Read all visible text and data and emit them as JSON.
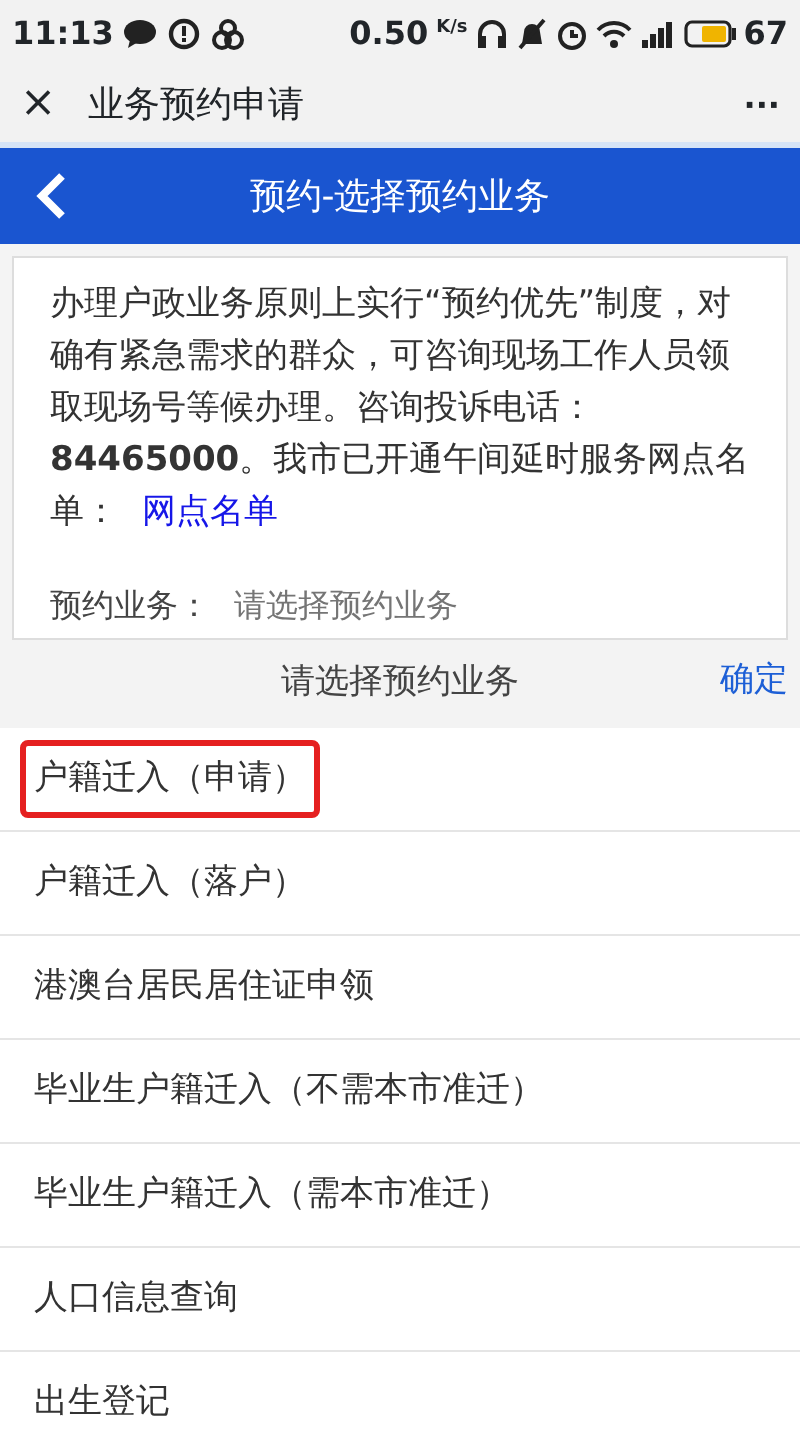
{
  "status_bar": {
    "time": "11:13",
    "speed": "0.50",
    "speed_unit": "K/s",
    "battery": "67"
  },
  "title_bar": {
    "close": "×",
    "title": "业务预约申请",
    "more": "···"
  },
  "header": {
    "title": "预约-选择预约业务"
  },
  "notice": {
    "text": "办理户政业务原则上实行“预约优先”制度，对确有紧急需求的群众，可咨询现场工作人员领取现场号等候办理。咨询投诉电话：**84465000**。我市已开通午间延时服务网点名单：",
    "link": "网点名单"
  },
  "form": {
    "label": "预约业务：",
    "placeholder": "请选择预约业务"
  },
  "picker": {
    "title": "请选择预约业务",
    "confirm": "确定",
    "items": [
      {
        "label": "户籍迁入（申请）",
        "highlighted": true
      },
      {
        "label": "户籍迁入（落户）",
        "highlighted": false
      },
      {
        "label": "港澳台居民居住证申领",
        "highlighted": false
      },
      {
        "label": "毕业生户籍迁入（不需本市准迁）",
        "highlighted": false
      },
      {
        "label": "毕业生户籍迁入（需本市准迁）",
        "highlighted": false
      },
      {
        "label": "人口信息查询",
        "highlighted": false
      },
      {
        "label": "出生登记",
        "highlighted": false
      }
    ]
  }
}
